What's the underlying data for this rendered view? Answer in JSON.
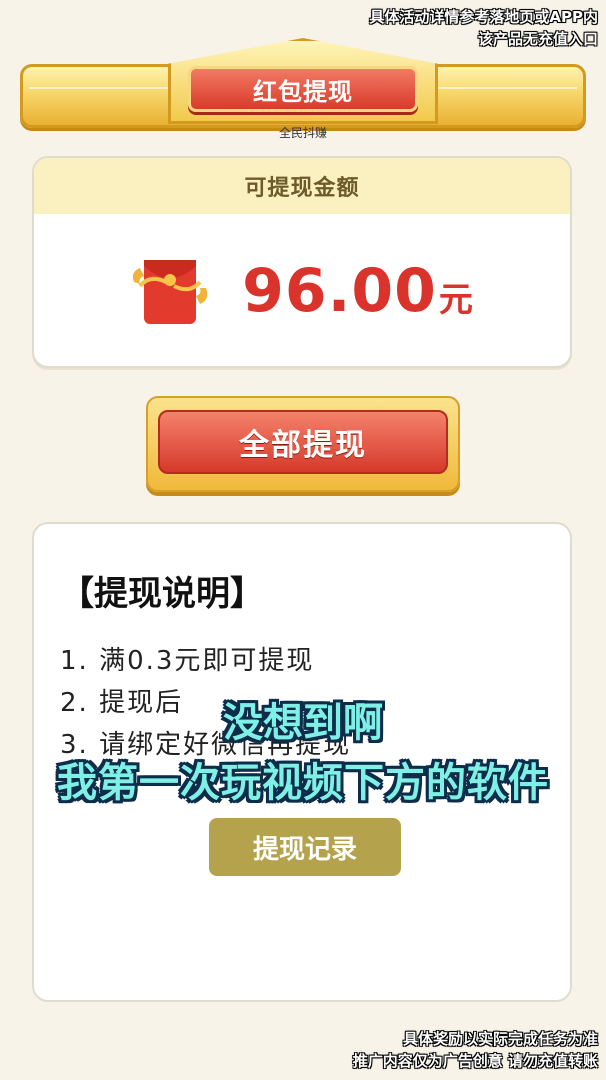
{
  "notices": {
    "top_line1": "具体活动详情参考落地页或APP内",
    "top_line2": "该产品无充值入口",
    "bottom_line1": "具体奖励以实际完成任务为准",
    "bottom_line2": "推广内容仅为广告创意  请勿充值转账"
  },
  "header": {
    "title": "红包提现",
    "app_name": "全民抖赚"
  },
  "balance": {
    "label": "可提现金额",
    "amount": "96.00",
    "unit": "元",
    "icon": "red-packet-icon"
  },
  "actions": {
    "withdraw_all": "全部提现",
    "records": "提现记录"
  },
  "instructions": {
    "title": "【提现说明】",
    "items": [
      "1. 满0.3元即可提现",
      "2. 提现后",
      "3. 请绑定好微信再提现"
    ]
  },
  "subtitles": {
    "line1": "没想到啊",
    "line2": "我第一次玩视频下方的软件"
  },
  "colors": {
    "accent_red": "#d9332b",
    "gold": "#f0b93a",
    "record_button": "#b5a24c",
    "subtitle": "#7ff0e6"
  }
}
